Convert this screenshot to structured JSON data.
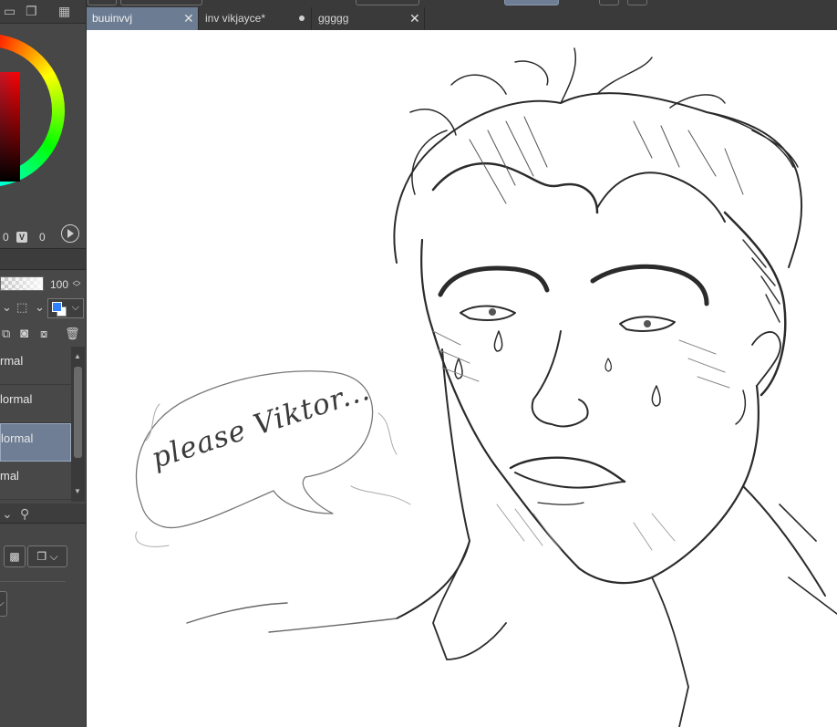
{
  "document_tabs": [
    {
      "label": "buuinvvj",
      "active": true,
      "closable": true
    },
    {
      "label": "inv vikjayce*",
      "active": false,
      "closable": false,
      "modified": true
    },
    {
      "label": "ggggg",
      "active": false,
      "closable": true
    }
  ],
  "color_panel": {
    "values": [
      "0",
      "0"
    ],
    "v_badge": "V",
    "selected_color": "#c81525"
  },
  "layer_panel": {
    "opacity": "100",
    "layers": [
      {
        "mode": "rmal",
        "selected": false
      },
      {
        "mode": "lormal",
        "selected": false
      },
      {
        "mode": "lormal",
        "selected": true
      },
      {
        "mode": "mal",
        "selected": false
      }
    ]
  },
  "canvas": {
    "speech_bubble_text": "please Viktor..."
  },
  "colors": {
    "accent_selected": "#6f7e94",
    "panel_bg": "#474747",
    "canvas_bg": "#ffffff",
    "main_color": "#2f7fff",
    "sub_color": "#ffffff"
  },
  "icons": [
    "fx-icon",
    "layers-icon",
    "film-icon",
    "play-icon",
    "layer-mask-icon",
    "new-layer-icon",
    "delete-icon",
    "checker-icon",
    "copy-icon"
  ]
}
